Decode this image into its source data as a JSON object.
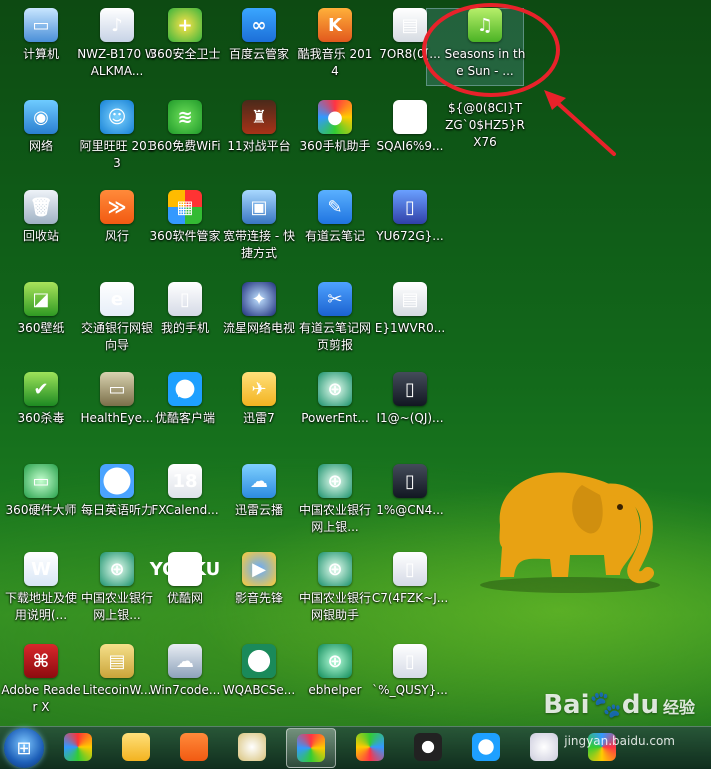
{
  "desktop": {
    "icons": [
      {
        "label": "计算机",
        "glyph": "▭",
        "cls": "c-pc"
      },
      {
        "label": "NWZ-B170 WALKMA...",
        "glyph": "♪",
        "cls": "c-walk"
      },
      {
        "label": "360安全卫士",
        "glyph": "+",
        "cls": "c-360"
      },
      {
        "label": "百度云管家",
        "glyph": "∞",
        "cls": "c-baidu"
      },
      {
        "label": "酷我音乐 2014",
        "glyph": "K",
        "cls": "c-kuwo"
      },
      {
        "label": "7OR8(0[...",
        "glyph": "▤",
        "cls": "c-file"
      },
      {
        "label": "Seasons in the Sun - ...",
        "glyph": "♫",
        "cls": "c-music"
      },
      {
        "label": "网络",
        "glyph": "◉",
        "cls": "c-net"
      },
      {
        "label": "阿里旺旺 2013",
        "glyph": "☺",
        "cls": "c-wang"
      },
      {
        "label": "360免费WiFi",
        "glyph": "≋",
        "cls": "c-wifi"
      },
      {
        "label": "11对战平台",
        "glyph": "♜",
        "cls": "c-11"
      },
      {
        "label": "360手机助手",
        "glyph": "●",
        "cls": "c-helper"
      },
      {
        "label": "SQAI6%9...",
        "glyph": "▦",
        "cls": "c-qr"
      },
      {
        "label": "${@0(8CI}TZG`0$HZ5}RX76",
        "glyph": "",
        "cls": ""
      },
      {
        "label": "回收站",
        "glyph": "🗑",
        "cls": "c-bin"
      },
      {
        "label": "风行",
        "glyph": "≫",
        "cls": "c-fx"
      },
      {
        "label": "360软件管家",
        "glyph": "▦",
        "cls": "c-soft"
      },
      {
        "label": "宽带连接 - 快捷方式",
        "glyph": "▣",
        "cls": "c-bb"
      },
      {
        "label": "有道云笔记",
        "glyph": "✎",
        "cls": "c-note"
      },
      {
        "label": "YU672G}...",
        "glyph": "▯",
        "cls": "c-phone"
      },
      {
        "label": "360壁纸",
        "glyph": "◪",
        "cls": "c-wall"
      },
      {
        "label": "交通银行网银向导",
        "glyph": "e",
        "cls": "c-bank"
      },
      {
        "label": "我的手机",
        "glyph": "▯",
        "cls": "c-myphone"
      },
      {
        "label": "流星网络电视",
        "glyph": "✦",
        "cls": "c-star"
      },
      {
        "label": "有道云笔记网页剪报",
        "glyph": "✂",
        "cls": "c-clip"
      },
      {
        "label": "E}1WVR0...",
        "glyph": "▤",
        "cls": "c-file"
      },
      {
        "label": "360杀毒",
        "glyph": "✔",
        "cls": "c-shield"
      },
      {
        "label": "HealthEye...",
        "glyph": "▭",
        "cls": "c-monitor"
      },
      {
        "label": "优酷客户端",
        "glyph": "▶",
        "cls": "c-youku"
      },
      {
        "label": "迅雷7",
        "glyph": "✈",
        "cls": "c-xl"
      },
      {
        "label": "PowerEnt...",
        "glyph": "⊕",
        "cls": "c-abc"
      },
      {
        "label": "I1@~(QJ)...",
        "glyph": "▯",
        "cls": "c-dark"
      },
      {
        "label": "360硬件大师",
        "glyph": "▭",
        "cls": "c-hw"
      },
      {
        "label": "每日英语听力",
        "glyph": "◔",
        "cls": "c-en"
      },
      {
        "label": "FXCalend...",
        "glyph": "18",
        "cls": "c-cal"
      },
      {
        "label": "迅雷云播",
        "glyph": "☁",
        "cls": "c-cloud"
      },
      {
        "label": "中国农业银行网上银...",
        "glyph": "⊕",
        "cls": "c-abc"
      },
      {
        "label": "1%@CN4...",
        "glyph": "▯",
        "cls": "c-dark"
      },
      {
        "label": "下载地址及使用说明(...",
        "glyph": "W",
        "cls": "c-word"
      },
      {
        "label": "中国农业银行网上银...",
        "glyph": "⊕",
        "cls": "c-abc"
      },
      {
        "label": "优酷网",
        "glyph": "YOUKU",
        "cls": "c-yk"
      },
      {
        "label": "影音先锋",
        "glyph": "▶",
        "cls": "c-ying"
      },
      {
        "label": "中国农业银行网银助手",
        "glyph": "⊕",
        "cls": "c-abc"
      },
      {
        "label": "C7(4FZK~J...",
        "glyph": "▯",
        "cls": "c-myphone"
      },
      {
        "label": "Adobe Reader X",
        "glyph": "⌘",
        "cls": "c-pdf"
      },
      {
        "label": "LitecoinW...",
        "glyph": "▤",
        "cls": "c-lite"
      },
      {
        "label": "Win7code...",
        "glyph": "☁",
        "cls": "c-win7"
      },
      {
        "label": "WQABCSe...",
        "glyph": "⊕",
        "cls": "c-wq"
      },
      {
        "label": "ebhelper",
        "glyph": "⊕",
        "cls": "c-eb"
      },
      {
        "label": "`%_QUSY}...",
        "glyph": "▯",
        "cls": "c-myphone"
      }
    ],
    "highlighted_label": "Seasons in the Sun - ..."
  },
  "watermark": {
    "brand": "Bai",
    "paw": "du",
    "jy": "经验",
    "url": "jingyan.baidu.com"
  },
  "taskbar": {
    "start_glyph": "⊞",
    "items": [
      {
        "name": "pinwheel",
        "active": false,
        "bg": "conic-gradient(#f33,#fc0,#3c3,#39f,#f33)"
      },
      {
        "name": "xunlei",
        "active": false,
        "bg": "linear-gradient(#ffe07a,#f3b320)"
      },
      {
        "name": "funshion",
        "active": false,
        "bg": "linear-gradient(#ff8a3a,#f25a12)"
      },
      {
        "name": "paint",
        "active": false,
        "bg": "radial-gradient(circle,#fff,#d8c27a)"
      },
      {
        "name": "helper",
        "active": true,
        "bg": "conic-gradient(#f34,#fc0,#3c3,#39f,#f34)"
      },
      {
        "name": "helper2",
        "active": false,
        "bg": "conic-gradient(#3c3,#39f,#f34,#fc0,#3c3)"
      },
      {
        "name": "qq",
        "active": false,
        "bg": "radial-gradient(circle,#fff 30%,#222 32%)"
      },
      {
        "name": "youku",
        "active": false,
        "bg": "radial-gradient(circle,#fff 38%,#1ea0ff 40%)"
      },
      {
        "name": "bulb",
        "active": false,
        "bg": "radial-gradient(circle,#fff,#ccd)"
      },
      {
        "name": "pinwheel2",
        "active": false,
        "bg": "conic-gradient(#39f,#f34,#fc0,#3c3,#39f)"
      }
    ]
  }
}
